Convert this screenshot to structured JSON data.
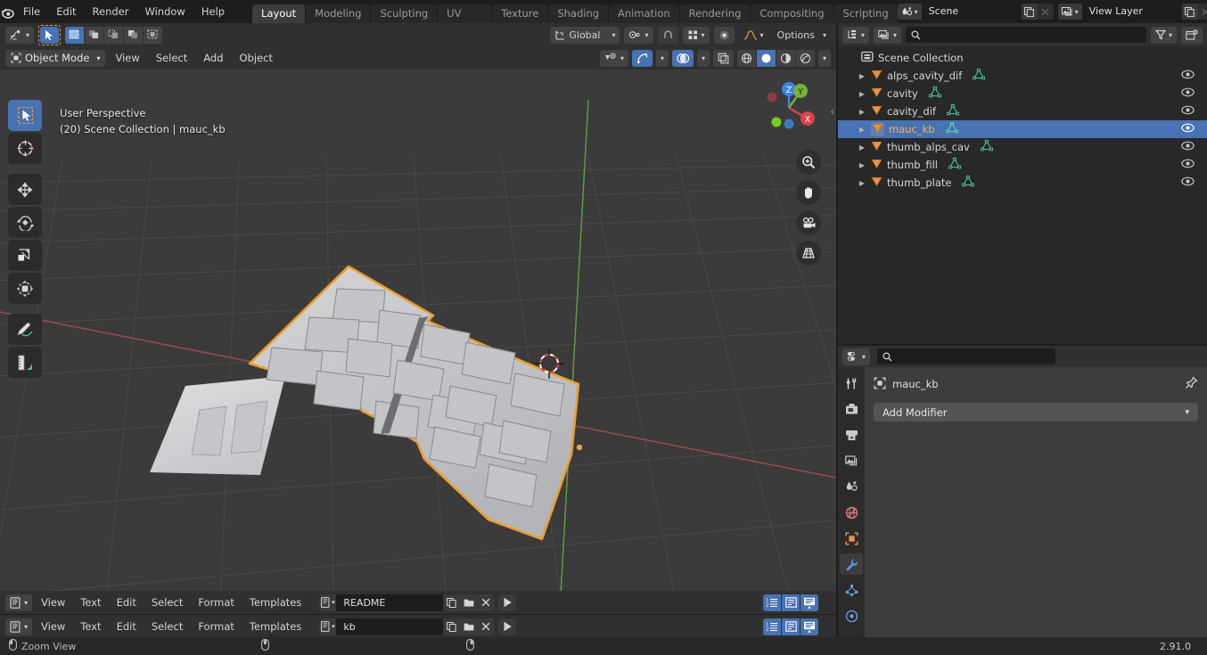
{
  "app": {
    "name": "Blender",
    "version": "2.91.0"
  },
  "topbar": {
    "menus": [
      "File",
      "Edit",
      "Render",
      "Window",
      "Help"
    ],
    "workspaces": [
      {
        "label": "Layout",
        "active": true
      },
      {
        "label": "Modeling",
        "active": false
      },
      {
        "label": "Sculpting",
        "active": false
      },
      {
        "label": "UV Editing",
        "active": false
      },
      {
        "label": "Texture Paint",
        "active": false
      },
      {
        "label": "Shading",
        "active": false
      },
      {
        "label": "Animation",
        "active": false
      },
      {
        "label": "Rendering",
        "active": false
      },
      {
        "label": "Compositing",
        "active": false
      },
      {
        "label": "Scripting",
        "active": false
      }
    ],
    "scene": {
      "label": "Scene",
      "icon": "scene-icon"
    },
    "view_layer": {
      "label": "View Layer",
      "icon": "view-layer-icon"
    }
  },
  "viewport": {
    "mode": "Object Mode",
    "header_menus": [
      "View",
      "Select",
      "Add",
      "Object"
    ],
    "transform_orientation": "Global",
    "options_label": "Options",
    "overlay": {
      "line1": "User Perspective",
      "line2": "(20) Scene Collection | mauc_kb"
    },
    "gizmo_axes": [
      "X",
      "Y",
      "Z"
    ],
    "nav_buttons": [
      "zoom-icon",
      "hand-icon",
      "camera-icon",
      "grid-icon"
    ],
    "tools": [
      {
        "name": "tweak-select-box",
        "active": true
      },
      {
        "name": "cursor",
        "active": false
      },
      {
        "name": "move",
        "active": false
      },
      {
        "name": "rotate",
        "active": false
      },
      {
        "name": "scale",
        "active": false
      },
      {
        "name": "transform",
        "active": false
      },
      {
        "name": "annotate",
        "active": false
      },
      {
        "name": "measure",
        "active": false
      }
    ],
    "select_modes": [
      "set",
      "extend",
      "subtract",
      "invert",
      "intersect"
    ],
    "shading_modes": [
      "wireframe",
      "solid",
      "material-preview",
      "rendered"
    ],
    "active_shading": "solid"
  },
  "outliner": {
    "search_placeholder": "",
    "items": [
      {
        "label": "Scene Collection",
        "type": "collection",
        "indent": 0,
        "selected": false
      },
      {
        "label": "alps_cavity_dif",
        "type": "mesh",
        "indent": 1,
        "selected": false
      },
      {
        "label": "cavity",
        "type": "mesh",
        "indent": 1,
        "selected": false
      },
      {
        "label": "cavity_dif",
        "type": "mesh",
        "indent": 1,
        "selected": false
      },
      {
        "label": "mauc_kb",
        "type": "mesh",
        "indent": 1,
        "selected": true
      },
      {
        "label": "thumb_alps_cav",
        "type": "mesh",
        "indent": 1,
        "selected": false
      },
      {
        "label": "thumb_fill",
        "type": "mesh",
        "indent": 1,
        "selected": false
      },
      {
        "label": "thumb_plate",
        "type": "mesh",
        "indent": 1,
        "selected": false
      }
    ]
  },
  "properties": {
    "search_placeholder": "",
    "breadcrumb_object": "mauc_kb",
    "add_modifier_label": "Add Modifier",
    "tabs": [
      {
        "name": "tool",
        "active": false
      },
      {
        "name": "render",
        "active": false
      },
      {
        "name": "output",
        "active": false
      },
      {
        "name": "view-layer",
        "active": false
      },
      {
        "name": "scene",
        "active": false
      },
      {
        "name": "world",
        "active": false
      },
      {
        "name": "object",
        "active": false
      },
      {
        "name": "modifier",
        "active": true
      },
      {
        "name": "particles",
        "active": false
      },
      {
        "name": "physics",
        "active": false
      }
    ]
  },
  "text_editors": [
    {
      "menus": [
        "View",
        "Text",
        "Edit",
        "Select",
        "Format",
        "Templates"
      ],
      "datablock": "README"
    },
    {
      "menus": [
        "View",
        "Text",
        "Edit",
        "Select",
        "Format",
        "Templates"
      ],
      "datablock": "kb"
    }
  ],
  "statusbar": {
    "hint": "Zoom View",
    "version": "2.91.0"
  },
  "colors": {
    "accent_blue": "#4772b3",
    "select_orange": "#ed9e2d",
    "mesh_icon": "#4bc190",
    "object_icon": "#e89545"
  }
}
